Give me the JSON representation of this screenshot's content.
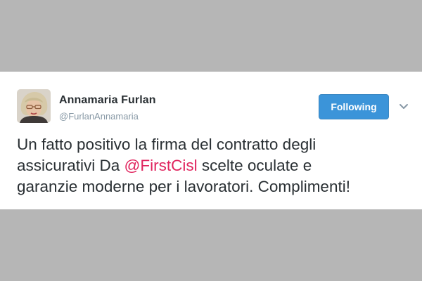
{
  "tweet": {
    "author": {
      "display_name": "Annamaria Furlan",
      "handle": "@FurlanAnnamaria",
      "avatar_icon": "user-avatar-photo"
    },
    "follow_button_label": "Following",
    "more_icon": "chevron-down-icon",
    "text": {
      "line1": "Un fatto positivo la firma del contratto degli",
      "line2_before": "assicurativi Da ",
      "mention": "@FirstCisl",
      "line2_after": " scelte oculate e",
      "line3": "garanzie moderne per i lavoratori. Complimenti!"
    }
  },
  "colors": {
    "page_background": "#b6b6b6",
    "card_background": "#ffffff",
    "follow_button": "#3b94d9",
    "mention": "#e0245e",
    "text": "#292f33",
    "muted_text": "#8899a6"
  }
}
